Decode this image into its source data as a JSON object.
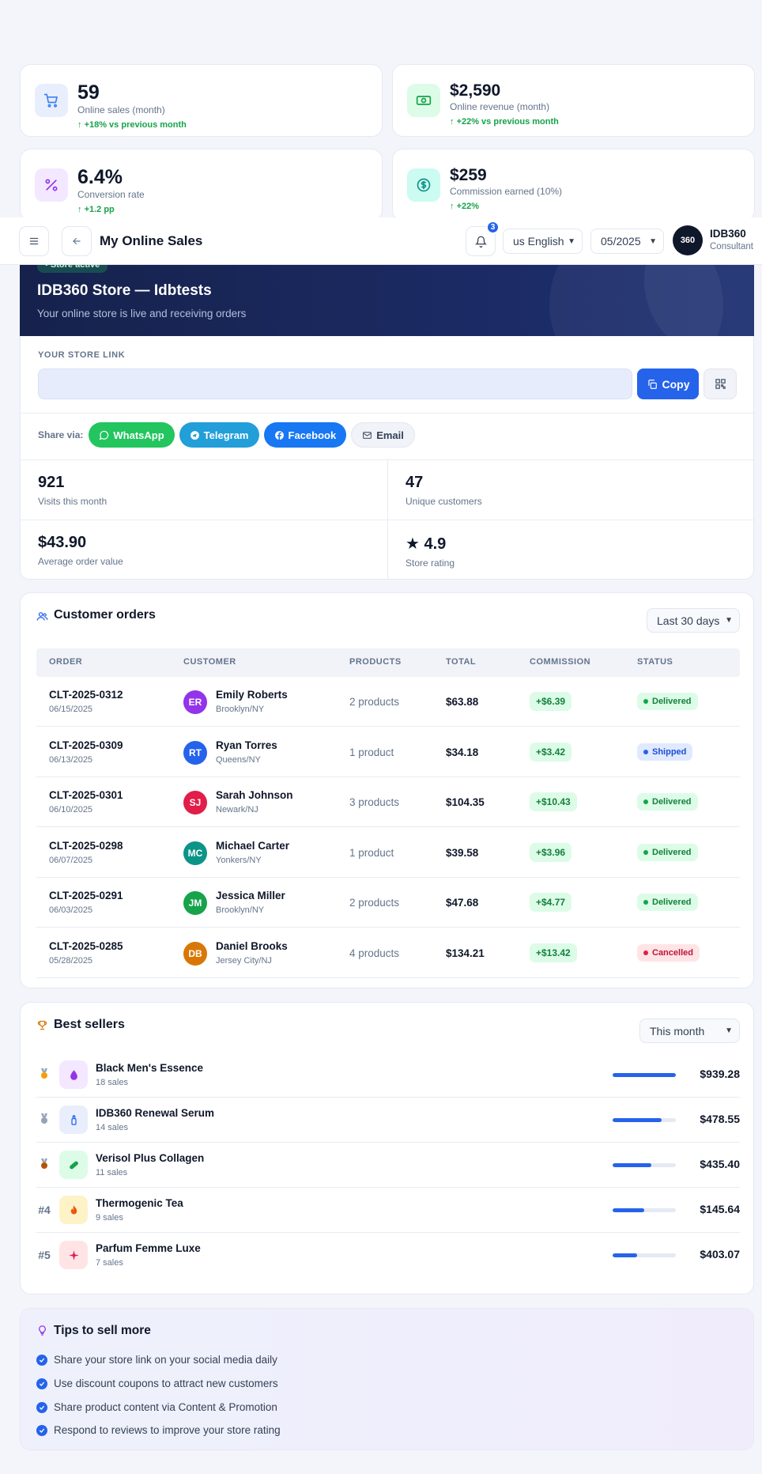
{
  "kpis": [
    {
      "value": "59",
      "label": "Online sales (month)",
      "change": "+18% vs previous month",
      "icon": "cart-icon",
      "color": "#3b82f6"
    },
    {
      "value": "$2,590",
      "label": "Online revenue (month)",
      "change": "+22% vs previous month",
      "icon": "money-icon",
      "color": "#16a34a"
    },
    {
      "value": "6.4%",
      "label": "Conversion rate",
      "change": "+1.2 pp",
      "icon": "percent-icon",
      "color": "#9333ea"
    },
    {
      "value": "$259",
      "label": "Commission earned (10%)",
      "change": "+22%",
      "icon": "dollar-coin-icon",
      "color": "#0d9488"
    }
  ],
  "header": {
    "title": "My Online Sales",
    "notifications": "3",
    "language": "us English",
    "period": "05/2025",
    "avatar": "360",
    "user_name": "IDB360",
    "user_role": "Consultant"
  },
  "store": {
    "badge": "• Store active",
    "title": "IDB360 Store — Idbtests",
    "subtitle": "Your online store is live and receiving orders",
    "link_label": "YOUR STORE LINK",
    "link_value": "",
    "copy_label": "Copy",
    "share_label": "Share via:",
    "share": [
      "WhatsApp",
      "Telegram",
      "Facebook",
      "Email"
    ],
    "stats": [
      {
        "value": "921",
        "label": "Visits this month"
      },
      {
        "value": "47",
        "label": "Unique customers"
      },
      {
        "value": "$43.90",
        "label": "Average order value"
      },
      {
        "value": "★ 4.9",
        "label": "Store rating"
      }
    ]
  },
  "orders": {
    "title": "Customer orders",
    "filter": "Last 30 days",
    "columns": [
      "ORDER",
      "CUSTOMER",
      "PRODUCTS",
      "TOTAL",
      "COMMISSION",
      "STATUS"
    ],
    "rows": [
      {
        "id": "CLT-2025-0312",
        "date": "06/15/2025",
        "initials": "ER",
        "av_color": "#9333ea",
        "name": "Emily Roberts",
        "loc": "Brooklyn/NY",
        "products": "2 products",
        "total": "$63.88",
        "commission": "+$6.39",
        "status": "Delivered"
      },
      {
        "id": "CLT-2025-0309",
        "date": "06/13/2025",
        "initials": "RT",
        "av_color": "#2563eb",
        "name": "Ryan Torres",
        "loc": "Queens/NY",
        "products": "1 product",
        "total": "$34.18",
        "commission": "+$3.42",
        "status": "Shipped"
      },
      {
        "id": "CLT-2025-0301",
        "date": "06/10/2025",
        "initials": "SJ",
        "av_color": "#e11d48",
        "name": "Sarah Johnson",
        "loc": "Newark/NJ",
        "products": "3 products",
        "total": "$104.35",
        "commission": "+$10.43",
        "status": "Delivered"
      },
      {
        "id": "CLT-2025-0298",
        "date": "06/07/2025",
        "initials": "MC",
        "av_color": "#0d9488",
        "name": "Michael Carter",
        "loc": "Yonkers/NY",
        "products": "1 product",
        "total": "$39.58",
        "commission": "+$3.96",
        "status": "Delivered"
      },
      {
        "id": "CLT-2025-0291",
        "date": "06/03/2025",
        "initials": "JM",
        "av_color": "#16a34a",
        "name": "Jessica Miller",
        "loc": "Brooklyn/NY",
        "products": "2 products",
        "total": "$47.68",
        "commission": "+$4.77",
        "status": "Delivered"
      },
      {
        "id": "CLT-2025-0285",
        "date": "05/28/2025",
        "initials": "DB",
        "av_color": "#d97706",
        "name": "Daniel Brooks",
        "loc": "Jersey City/NJ",
        "products": "4 products",
        "total": "$134.21",
        "commission": "+$13.42",
        "status": "Cancelled"
      }
    ]
  },
  "best": {
    "title": "Best sellers",
    "filter": "This month",
    "items": [
      {
        "rank": "",
        "medal": "#f59e0b",
        "name": "Black Men's Essence",
        "sales": "18 sales",
        "revenue": "$939.28",
        "share": 1.0,
        "icon_bg": "#f3e8ff",
        "icon_color": "#9333ea",
        "icon": "droplet-icon"
      },
      {
        "rank": "",
        "medal": "#94a3b8",
        "name": "IDB360 Renewal Serum",
        "sales": "14 sales",
        "revenue": "$478.55",
        "share": 0.78,
        "icon_bg": "#e8eefc",
        "icon_color": "#2563eb",
        "icon": "serum-icon"
      },
      {
        "rank": "",
        "medal": "#b45309",
        "name": "Verisol Plus Collagen",
        "sales": "11 sales",
        "revenue": "$435.40",
        "share": 0.61,
        "icon_bg": "#dcfce7",
        "icon_color": "#16a34a",
        "icon": "capsule-icon"
      },
      {
        "rank": "#4",
        "medal": "",
        "name": "Thermogenic Tea",
        "sales": "9 sales",
        "revenue": "$145.64",
        "share": 0.5,
        "icon_bg": "#fef3c7",
        "icon_color": "#ea580c",
        "icon": "flame-icon"
      },
      {
        "rank": "#5",
        "medal": "",
        "name": "Parfum Femme Luxe",
        "sales": "7 sales",
        "revenue": "$403.07",
        "share": 0.39,
        "icon_bg": "#ffe4e6",
        "icon_color": "#e11d48",
        "icon": "sparkle-icon"
      }
    ]
  },
  "tips": {
    "title": "Tips to sell more",
    "items": [
      "Share your store link on your social media daily",
      "Use discount coupons to attract new customers",
      "Share product content via Content & Promotion",
      "Respond to reviews to improve your store rating"
    ]
  }
}
